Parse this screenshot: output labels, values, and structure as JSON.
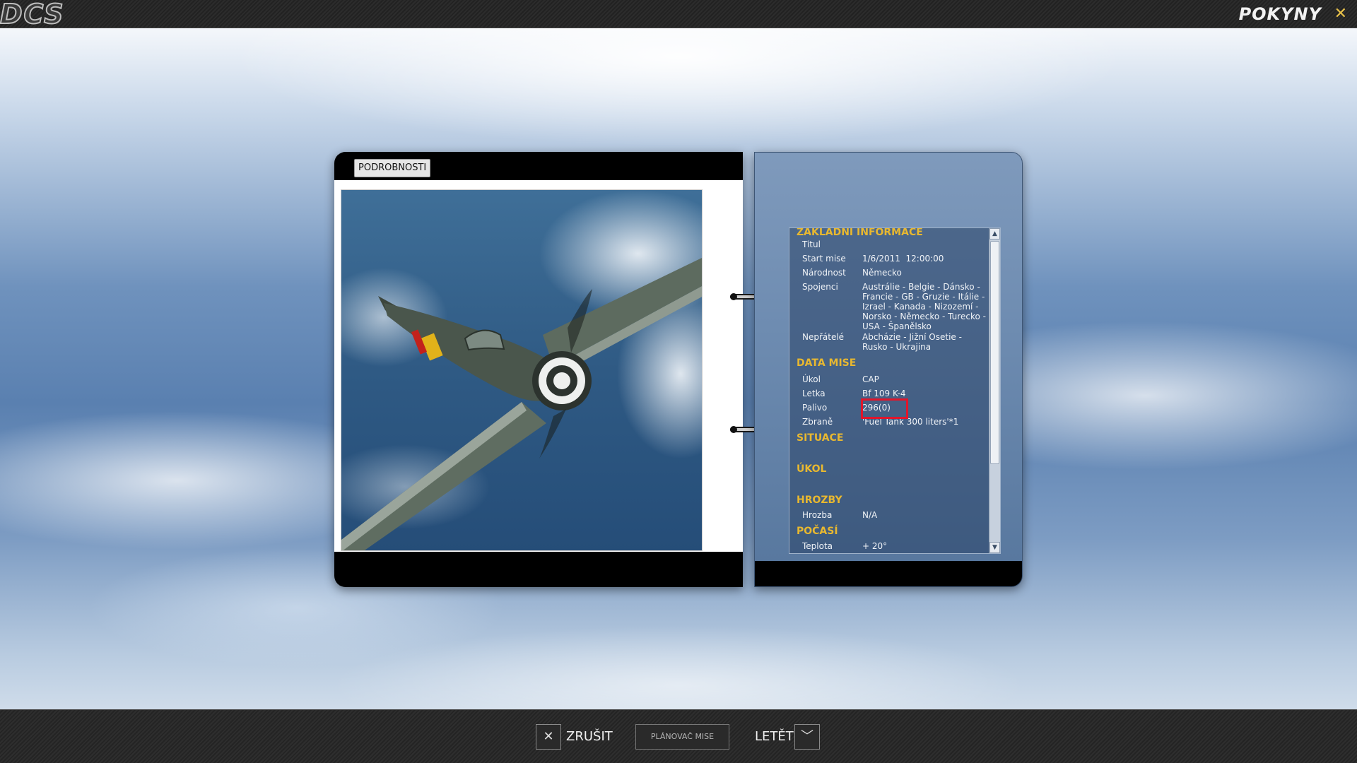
{
  "app": {
    "logo": "DCS",
    "title": "POKYNY",
    "close_symbol": "✕"
  },
  "left_page": {
    "tab_label": "PODROBNOSTI"
  },
  "info": {
    "sections": {
      "basic": "ZÁKLADNÍ INFORMACE",
      "mission_data": "DATA MISE",
      "situation": "SITUACE",
      "task": "ÚKOL",
      "threats": "HROZBY",
      "weather": "POČASÍ"
    },
    "basic": {
      "title_label": "Titul",
      "title_value": "",
      "start_label": "Start mise",
      "start_value": "1/6/2011  12:00:00",
      "nationality_label": "Národnost",
      "nationality_value": "Německo",
      "allies_label": "Spojenci",
      "allies_value": "Austrálie - Belgie - Dánsko - Francie - GB - Gruzie - Itálie - Izrael - Kanada - Nizozemí - Norsko - Německo - Turecko - USA - Španělsko",
      "enemies_label": "Nepřátelé",
      "enemies_value": "Abcházie - Jižní Osetie - Rusko - Ukrajina"
    },
    "mission_data": {
      "task_label": "Úkol",
      "task_value": "CAP",
      "flight_label": "Letka",
      "flight_value": "Bf 109 K-4",
      "fuel_label": "Palivo",
      "fuel_value": "296(0)",
      "weapons_label": "Zbraně",
      "weapons_value": "'Fuel Tank 300 liters'*1"
    },
    "threats": {
      "threat_label": "Hrozba",
      "threat_value": "N/A"
    },
    "weather": {
      "temp_label": "Teplota",
      "temp_value": "+ 20°"
    }
  },
  "bottom": {
    "cancel_icon": "✕",
    "cancel_label": "ZRUŠIT",
    "planner_label": "PLÁNOVAČ MISE",
    "fly_label": "LETĚT",
    "fly_icon": "﹀"
  },
  "colors": {
    "section_title": "#e8b830",
    "highlight": "#e0162b",
    "close_x": "#e8c14a"
  }
}
